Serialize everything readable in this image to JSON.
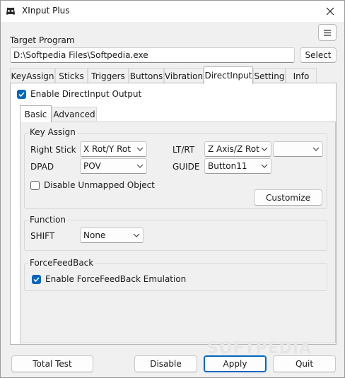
{
  "window": {
    "title": "XInput Plus"
  },
  "target": {
    "label": "Target Program",
    "path": "D:\\Softpedia Files\\Softpedia.exe",
    "select_label": "Select"
  },
  "tabs": [
    "KeyAssign",
    "Sticks",
    "Triggers",
    "Buttons",
    "Vibration",
    "DirectInput",
    "Setting",
    "Info"
  ],
  "active_tab": "DirectInput",
  "directinput": {
    "enable_label": "Enable DirectInput Output",
    "enable_checked": true,
    "subtabs": [
      "Basic",
      "Advanced"
    ],
    "active_subtab": "Basic",
    "key_assign": {
      "title": "Key Assign",
      "right_stick_label": "Right Stick",
      "right_stick_value": "X Rot/Y Rot",
      "ltrt_label": "LT/RT",
      "ltrt_value": "Z Axis/Z Rot",
      "ltrt_extra_value": "",
      "dpad_label": "DPAD",
      "dpad_value": "POV",
      "guide_label": "GUIDE",
      "guide_value": "Button11",
      "disable_unmapped_label": "Disable Unmapped Object",
      "disable_unmapped_checked": false,
      "customize_label": "Customize"
    },
    "function": {
      "title": "Function",
      "shift_label": "SHIFT",
      "shift_value": "None"
    },
    "forcefeedback": {
      "title": "ForceFeedBack",
      "enable_label": "Enable ForceFeedBack Emulation",
      "enable_checked": true
    }
  },
  "buttons": {
    "total_test": "Total Test",
    "disable": "Disable",
    "apply": "Apply",
    "quit": "Quit"
  },
  "watermark": "SOFTPEDIA",
  "colors": {
    "accent": "#0067c0",
    "background": "#f0f0f0"
  }
}
